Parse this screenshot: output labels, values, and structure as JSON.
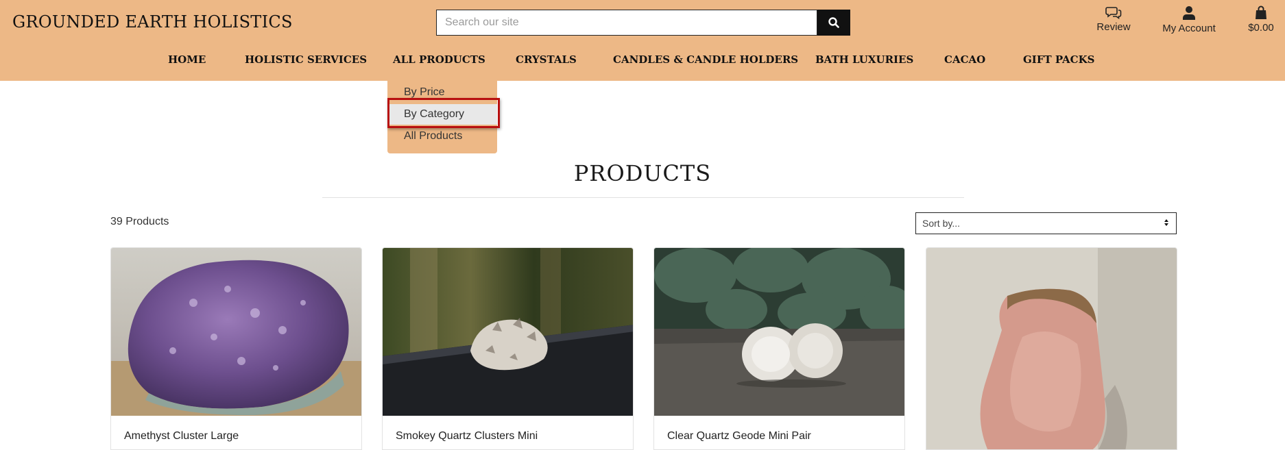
{
  "brand": {
    "name": "GROUNDED EARTH HOLISTICS"
  },
  "search": {
    "placeholder": "Search our site",
    "value": ""
  },
  "utilities": [
    {
      "icon": "chat-icon",
      "label": "Review"
    },
    {
      "icon": "user-icon",
      "label": "My Account"
    },
    {
      "icon": "shopping-bag-icon",
      "label": "$0.00"
    }
  ],
  "nav": [
    {
      "label": "HOME"
    },
    {
      "label": "HOLISTIC SERVICES"
    },
    {
      "label": "ALL PRODUCTS"
    },
    {
      "label": "CRYSTALS"
    },
    {
      "label": "CANDLES & CANDLE HOLDERS"
    },
    {
      "label": "BATH LUXURIES"
    },
    {
      "label": "CACAO"
    },
    {
      "label": "GIFT PACKS"
    }
  ],
  "dropdown": {
    "items": [
      {
        "label": "By Price"
      },
      {
        "label": "By Category"
      },
      {
        "label": "All Products"
      }
    ],
    "highlighted": "By Category"
  },
  "page": {
    "title": "PRODUCTS",
    "count_text": "39 Products",
    "sort_label": "Sort by..."
  },
  "products": [
    {
      "name": "Amethyst Cluster Large"
    },
    {
      "name": "Smokey Quartz Clusters Mini"
    },
    {
      "name": "Clear Quartz Geode Mini Pair"
    },
    {
      "name": ""
    }
  ],
  "colors": {
    "header_bg": "#edb886",
    "highlight_border": "#b80f0f",
    "search_button": "#111111"
  }
}
